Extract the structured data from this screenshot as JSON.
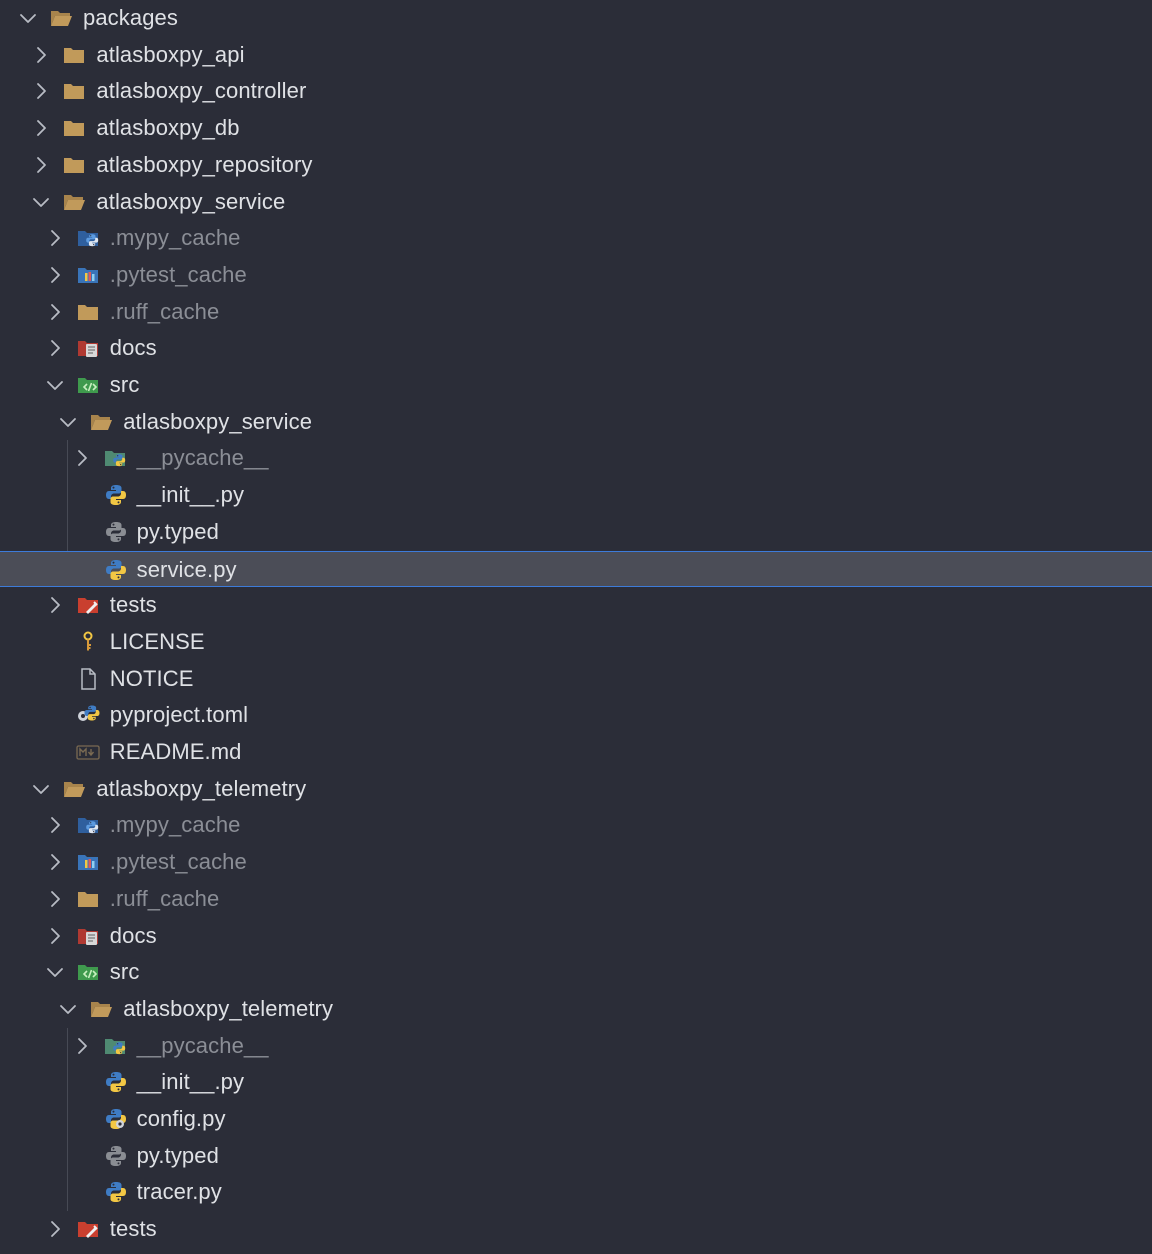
{
  "project_tree": {
    "items": [
      {
        "label": "packages",
        "depth": 0,
        "expanded": true,
        "icon": "folder-open-icon"
      },
      {
        "label": "atlasboxpy_api",
        "depth": 1,
        "expanded": false,
        "icon": "folder-icon"
      },
      {
        "label": "atlasboxpy_controller",
        "depth": 1,
        "expanded": false,
        "icon": "folder-icon"
      },
      {
        "label": "atlasboxpy_db",
        "depth": 1,
        "expanded": false,
        "icon": "folder-icon"
      },
      {
        "label": "atlasboxpy_repository",
        "depth": 1,
        "expanded": false,
        "icon": "folder-icon"
      },
      {
        "label": "atlasboxpy_service",
        "depth": 1,
        "expanded": true,
        "icon": "folder-open-icon"
      },
      {
        "label": ".mypy_cache",
        "depth": 2,
        "expanded": false,
        "icon": "mypy-folder-icon",
        "dim": true
      },
      {
        "label": ".pytest_cache",
        "depth": 2,
        "expanded": false,
        "icon": "pytest-folder-icon",
        "dim": true
      },
      {
        "label": ".ruff_cache",
        "depth": 2,
        "expanded": false,
        "icon": "folder-icon",
        "dim": true
      },
      {
        "label": "docs",
        "depth": 2,
        "expanded": false,
        "icon": "docs-folder-icon"
      },
      {
        "label": "src",
        "depth": 2,
        "expanded": true,
        "icon": "src-folder-icon"
      },
      {
        "label": "atlasboxpy_service",
        "depth": 3,
        "expanded": true,
        "icon": "folder-open-icon"
      },
      {
        "label": "__pycache__",
        "depth": 4,
        "expanded": false,
        "icon": "pycache-folder-icon",
        "dim": true
      },
      {
        "label": "__init__.py",
        "depth": 4,
        "icon": "python-file-icon"
      },
      {
        "label": "py.typed",
        "depth": 4,
        "icon": "python-typed-icon"
      },
      {
        "label": "service.py",
        "depth": 4,
        "icon": "python-file-icon",
        "selected": true
      },
      {
        "label": "tests",
        "depth": 2,
        "expanded": false,
        "icon": "tests-folder-icon"
      },
      {
        "label": "LICENSE",
        "depth": 2,
        "icon": "license-icon"
      },
      {
        "label": "NOTICE",
        "depth": 2,
        "icon": "file-icon"
      },
      {
        "label": "pyproject.toml",
        "depth": 2,
        "icon": "pyproject-icon"
      },
      {
        "label": "README.md",
        "depth": 2,
        "icon": "markdown-icon"
      },
      {
        "label": "atlasboxpy_telemetry",
        "depth": 1,
        "expanded": true,
        "icon": "folder-open-icon"
      },
      {
        "label": ".mypy_cache",
        "depth": 2,
        "expanded": false,
        "icon": "mypy-folder-icon",
        "dim": true
      },
      {
        "label": ".pytest_cache",
        "depth": 2,
        "expanded": false,
        "icon": "pytest-folder-icon",
        "dim": true
      },
      {
        "label": ".ruff_cache",
        "depth": 2,
        "expanded": false,
        "icon": "folder-icon",
        "dim": true
      },
      {
        "label": "docs",
        "depth": 2,
        "expanded": false,
        "icon": "docs-folder-icon"
      },
      {
        "label": "src",
        "depth": 2,
        "expanded": true,
        "icon": "src-folder-icon"
      },
      {
        "label": "atlasboxpy_telemetry",
        "depth": 3,
        "expanded": true,
        "icon": "folder-open-icon"
      },
      {
        "label": "__pycache__",
        "depth": 4,
        "expanded": false,
        "icon": "pycache-folder-icon",
        "dim": true
      },
      {
        "label": "__init__.py",
        "depth": 4,
        "icon": "python-file-icon"
      },
      {
        "label": "config.py",
        "depth": 4,
        "icon": "python-config-icon"
      },
      {
        "label": "py.typed",
        "depth": 4,
        "icon": "python-typed-icon"
      },
      {
        "label": "tracer.py",
        "depth": 4,
        "icon": "python-file-icon"
      },
      {
        "label": "tests",
        "depth": 2,
        "expanded": false,
        "icon": "tests-folder-icon"
      }
    ]
  },
  "colors": {
    "background": "#2b2d38",
    "selection": "#4b4d57",
    "selection_border": "#3d7bd9",
    "text": "#dfe1e5",
    "dim_text": "#8b8e96",
    "folder": "#c19a5b",
    "python_blue": "#3f7cc4",
    "python_yellow": "#f2c744",
    "src_green": "#3f9a4e",
    "tests_red": "#c9402f"
  }
}
